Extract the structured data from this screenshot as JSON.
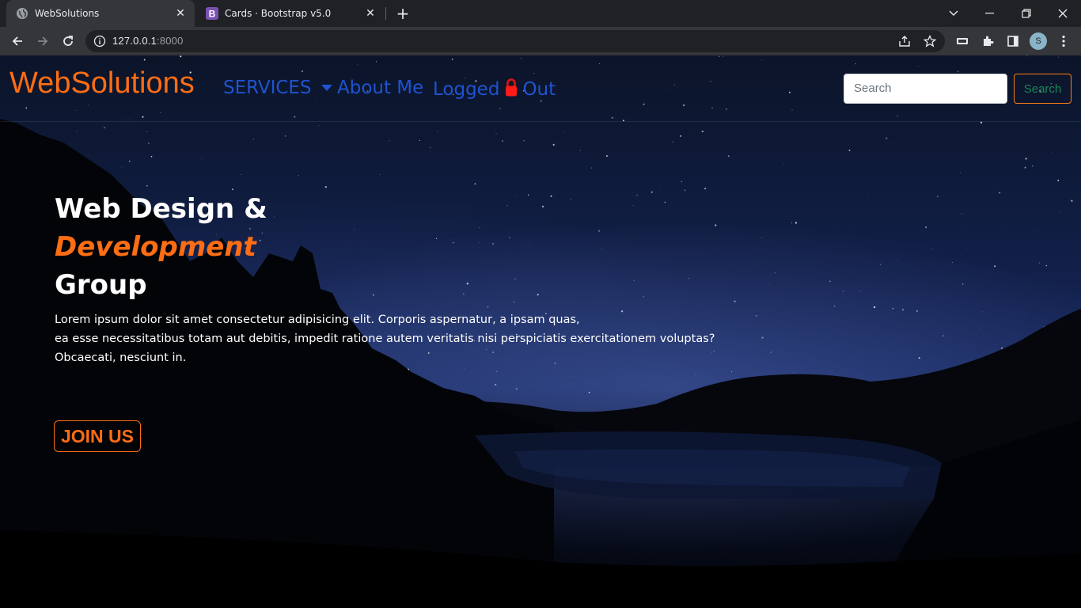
{
  "browser": {
    "tabs": [
      {
        "title": "WebSolutions",
        "favicon": "globe-icon",
        "active": true
      },
      {
        "title": "Cards · Bootstrap v5.0",
        "favicon": "bootstrap-icon",
        "favicon_letter": "B",
        "active": false
      }
    ],
    "url_host": "127.0.0.1",
    "url_port": ":8000",
    "profile_initial": "S"
  },
  "navbar": {
    "brand": "WebSolutions",
    "services_label": "SERVICES",
    "about_label": "About Me",
    "logged_label": "Logged",
    "out_label": "Out",
    "search_placeholder": "Search",
    "search_button": "Search"
  },
  "hero": {
    "heading_line1": "Web Design &",
    "heading_line2": "Development",
    "heading_line3": "Group",
    "paragraph_line1": "Lorem ipsum dolor sit amet consectetur adipisicing elit. Corporis aspernatur, a ipsam quas,",
    "paragraph_line2": "ea esse necessitatibus totam aut debitis, impedit ratione autem veritatis nisi perspiciatis exercitationem voluptas?",
    "paragraph_line3": "Obcaecati, nesciunt in.",
    "cta": "JOIN US"
  },
  "colors": {
    "accent": "#fd6d14",
    "nav_link": "#1f53d1",
    "search_button_text": "#198754"
  }
}
